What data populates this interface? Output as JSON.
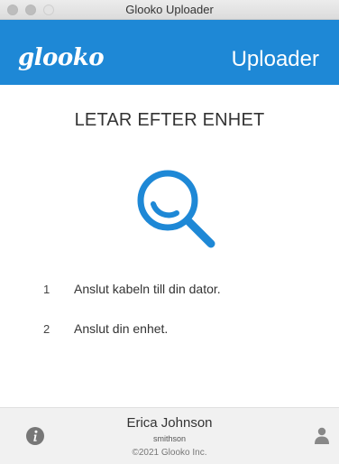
{
  "window": {
    "title": "Glooko Uploader"
  },
  "header": {
    "logo_text": "glooko",
    "title": "Uploader",
    "background_color": "#1e88d6"
  },
  "main": {
    "status_heading": "LETAR EFTER ENHET",
    "search_icon_color": "#1e88d6",
    "steps": [
      {
        "number": "1",
        "text": "Anslut kabeln till din dator."
      },
      {
        "number": "2",
        "text": "Anslut din enhet."
      }
    ]
  },
  "footer": {
    "user_name": "Erica Johnson",
    "user_id": "smithson",
    "copyright": "©2021 Glooko Inc.",
    "info_icon": "info-icon",
    "user_icon": "user-icon"
  }
}
